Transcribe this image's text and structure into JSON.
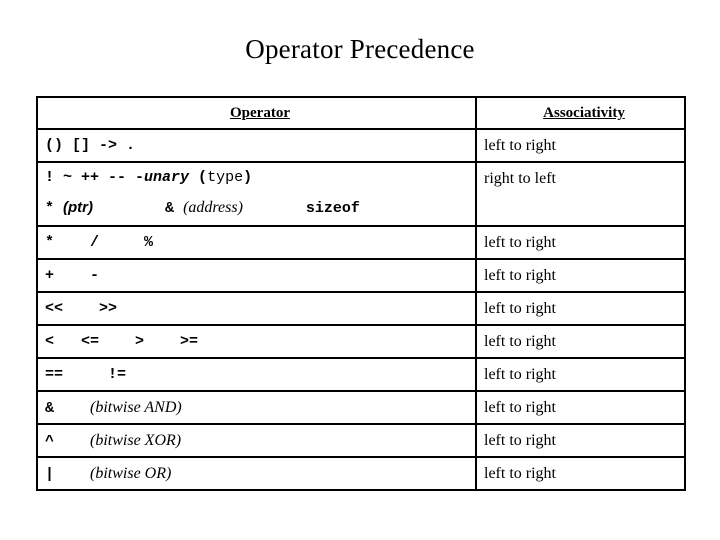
{
  "slide": {
    "title": "Operator Precedence"
  },
  "table": {
    "headers": {
      "operator": "Operator",
      "associativity": "Associativity"
    },
    "rows": [
      {
        "id": "row-postfix",
        "operator_text": "() [] -> .",
        "lines": [
          [
            {
              "t": "() [] -> .",
              "style": "mono"
            }
          ]
        ],
        "associativity": "left to right"
      },
      {
        "id": "row-unary",
        "operator_text": "! ~ ++ -- -unary (type)   * (ptr)   & (address)   sizeof",
        "lines": [
          [
            {
              "t": "! ~ ++ -- -",
              "style": "mono"
            },
            {
              "t": "unary",
              "style": "mono-i"
            },
            {
              "t": " (",
              "style": "mono"
            },
            {
              "t": "type",
              "style": "mono-plain"
            },
            {
              "t": ")",
              "style": "mono"
            }
          ],
          [
            {
              "t": "* ",
              "style": "mono"
            },
            {
              "t": "(ptr)",
              "style": "serif-bi"
            },
            {
              "t": "        ",
              "style": "mono"
            },
            {
              "t": "&",
              "style": "mono"
            },
            {
              "t": " ",
              "style": "mono"
            },
            {
              "t": "(address)",
              "style": "serif-i"
            },
            {
              "t": "       ",
              "style": "mono"
            },
            {
              "t": "sizeof",
              "style": "mono"
            }
          ]
        ],
        "associativity": "right to left"
      },
      {
        "id": "row-multiplicative",
        "operator_text": "*    /     %",
        "lines": [
          [
            {
              "t": "*    /     %",
              "style": "mono"
            }
          ]
        ],
        "associativity": "left to right"
      },
      {
        "id": "row-additive",
        "operator_text": "+    -",
        "lines": [
          [
            {
              "t": "+    -",
              "style": "mono"
            }
          ]
        ],
        "associativity": "left to right"
      },
      {
        "id": "row-shift",
        "operator_text": "<<    >>",
        "lines": [
          [
            {
              "t": "<<    >>",
              "style": "mono"
            }
          ]
        ],
        "associativity": "left to right"
      },
      {
        "id": "row-relational",
        "operator_text": "<   <=    >    >=",
        "lines": [
          [
            {
              "t": "<   <=    >    >=",
              "style": "mono"
            }
          ]
        ],
        "associativity": "left to right"
      },
      {
        "id": "row-equality",
        "operator_text": "==     !=",
        "lines": [
          [
            {
              "t": "==     !=",
              "style": "mono"
            }
          ]
        ],
        "associativity": "left to right"
      },
      {
        "id": "row-bitwise-and",
        "operator_text": "&    (bitwise AND)",
        "lines": [
          [
            {
              "t": "&    ",
              "style": "mono"
            },
            {
              "t": "(bitwise AND)",
              "style": "serif-i"
            }
          ]
        ],
        "associativity": "left to right"
      },
      {
        "id": "row-bitwise-xor",
        "operator_text": "^    (bitwise XOR)",
        "lines": [
          [
            {
              "t": "^    ",
              "style": "mono"
            },
            {
              "t": "(bitwise XOR)",
              "style": "serif-i"
            }
          ]
        ],
        "associativity": "left to right"
      },
      {
        "id": "row-bitwise-or",
        "operator_text": "|    (bitwise OR)",
        "lines": [
          [
            {
              "t": "|    ",
              "style": "mono"
            },
            {
              "t": "(bitwise OR)",
              "style": "serif-i"
            }
          ]
        ],
        "associativity": "left to right"
      }
    ]
  },
  "colors": {
    "background": "#ffffff",
    "text": "#000000",
    "border": "#000000"
  }
}
